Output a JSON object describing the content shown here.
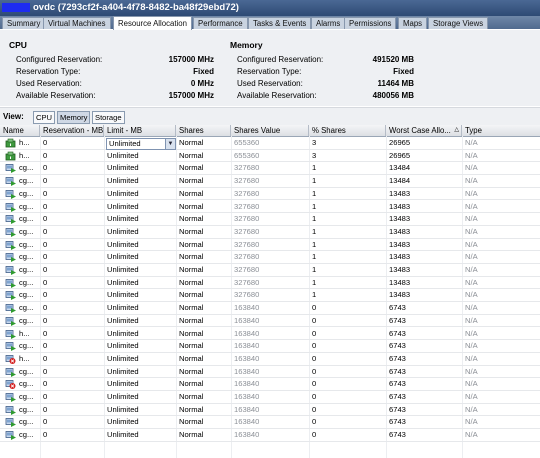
{
  "window": {
    "title": "ovdc (7293cf2f-a404-4f78-8482-ba48f29ebd72)"
  },
  "tabs": [
    {
      "label": "Summary",
      "active": false
    },
    {
      "label": "Virtual Machines",
      "active": false
    },
    {
      "label": "Resource Allocation",
      "active": true
    },
    {
      "label": "Performance",
      "active": false
    },
    {
      "label": "Tasks & Events",
      "active": false
    },
    {
      "label": "Alarms",
      "active": false
    },
    {
      "label": "Permissions",
      "active": false
    },
    {
      "label": "Maps",
      "active": false
    },
    {
      "label": "Storage Views",
      "active": false
    }
  ],
  "cpu": {
    "heading": "CPU",
    "rows": [
      {
        "label": "Configured Reservation:",
        "value": "157000 MHz"
      },
      {
        "label": "Reservation Type:",
        "value": "Fixed"
      },
      {
        "label": "Used Reservation:",
        "value": "0 MHz"
      },
      {
        "label": "Available Reservation:",
        "value": "157000 MHz"
      }
    ]
  },
  "memory": {
    "heading": "Memory",
    "rows": [
      {
        "label": "Configured Reservation:",
        "value": "491520 MB"
      },
      {
        "label": "Reservation Type:",
        "value": "Fixed"
      },
      {
        "label": "Used Reservation:",
        "value": "11464 MB"
      },
      {
        "label": "Available Reservation:",
        "value": "480056 MB"
      }
    ]
  },
  "view": {
    "label": "View:",
    "buttons": [
      {
        "label": "CPU",
        "selected": false
      },
      {
        "label": "Memory",
        "selected": true
      },
      {
        "label": "Storage",
        "selected": false
      }
    ]
  },
  "table": {
    "columns": [
      "Name",
      "Reservation - MB",
      "Limit - MB",
      "Shares",
      "Shares Value",
      "% Shares",
      "Worst Case Allo...",
      "Type"
    ],
    "sort_indicator": "△",
    "dropdown_arrow": "▼",
    "rows": [
      {
        "name": "h...",
        "reservation": "0",
        "limit": "Unlimited",
        "shares": "Normal",
        "shares_value": "655360",
        "pct": "3",
        "worst": "26965",
        "type": "N/A",
        "icon": "resource-pool-icon",
        "dropdown": true
      },
      {
        "name": "h...",
        "reservation": "0",
        "limit": "Unlimited",
        "shares": "Normal",
        "shares_value": "655360",
        "pct": "3",
        "worst": "26965",
        "type": "N/A",
        "icon": "resource-pool-icon"
      },
      {
        "name": "cg...",
        "reservation": "0",
        "limit": "Unlimited",
        "shares": "Normal",
        "shares_value": "327680",
        "pct": "1",
        "worst": "13484",
        "type": "N/A",
        "icon": "vm-on-icon"
      },
      {
        "name": "cg...",
        "reservation": "0",
        "limit": "Unlimited",
        "shares": "Normal",
        "shares_value": "327680",
        "pct": "1",
        "worst": "13484",
        "type": "N/A",
        "icon": "vm-on-icon"
      },
      {
        "name": "cg...",
        "reservation": "0",
        "limit": "Unlimited",
        "shares": "Normal",
        "shares_value": "327680",
        "pct": "1",
        "worst": "13483",
        "type": "N/A",
        "icon": "vm-on-icon"
      },
      {
        "name": "cg...",
        "reservation": "0",
        "limit": "Unlimited",
        "shares": "Normal",
        "shares_value": "327680",
        "pct": "1",
        "worst": "13483",
        "type": "N/A",
        "icon": "vm-on-icon"
      },
      {
        "name": "cg...",
        "reservation": "0",
        "limit": "Unlimited",
        "shares": "Normal",
        "shares_value": "327680",
        "pct": "1",
        "worst": "13483",
        "type": "N/A",
        "icon": "vm-on-icon"
      },
      {
        "name": "cg...",
        "reservation": "0",
        "limit": "Unlimited",
        "shares": "Normal",
        "shares_value": "327680",
        "pct": "1",
        "worst": "13483",
        "type": "N/A",
        "icon": "vm-on-icon"
      },
      {
        "name": "cg...",
        "reservation": "0",
        "limit": "Unlimited",
        "shares": "Normal",
        "shares_value": "327680",
        "pct": "1",
        "worst": "13483",
        "type": "N/A",
        "icon": "vm-on-icon"
      },
      {
        "name": "cg...",
        "reservation": "0",
        "limit": "Unlimited",
        "shares": "Normal",
        "shares_value": "327680",
        "pct": "1",
        "worst": "13483",
        "type": "N/A",
        "icon": "vm-on-icon"
      },
      {
        "name": "cg...",
        "reservation": "0",
        "limit": "Unlimited",
        "shares": "Normal",
        "shares_value": "327680",
        "pct": "1",
        "worst": "13483",
        "type": "N/A",
        "icon": "vm-on-icon"
      },
      {
        "name": "cg...",
        "reservation": "0",
        "limit": "Unlimited",
        "shares": "Normal",
        "shares_value": "327680",
        "pct": "1",
        "worst": "13483",
        "type": "N/A",
        "icon": "vm-on-icon"
      },
      {
        "name": "cg...",
        "reservation": "0",
        "limit": "Unlimited",
        "shares": "Normal",
        "shares_value": "327680",
        "pct": "1",
        "worst": "13483",
        "type": "N/A",
        "icon": "vm-on-icon"
      },
      {
        "name": "cg...",
        "reservation": "0",
        "limit": "Unlimited",
        "shares": "Normal",
        "shares_value": "163840",
        "pct": "0",
        "worst": "6743",
        "type": "N/A",
        "icon": "vm-on-icon"
      },
      {
        "name": "cg...",
        "reservation": "0",
        "limit": "Unlimited",
        "shares": "Normal",
        "shares_value": "163840",
        "pct": "0",
        "worst": "6743",
        "type": "N/A",
        "icon": "vm-on-icon"
      },
      {
        "name": "h...",
        "reservation": "0",
        "limit": "Unlimited",
        "shares": "Normal",
        "shares_value": "163840",
        "pct": "0",
        "worst": "6743",
        "type": "N/A",
        "icon": "vm-on-icon"
      },
      {
        "name": "cg...",
        "reservation": "0",
        "limit": "Unlimited",
        "shares": "Normal",
        "shares_value": "163840",
        "pct": "0",
        "worst": "6743",
        "type": "N/A",
        "icon": "vm-on-icon"
      },
      {
        "name": "h...",
        "reservation": "0",
        "limit": "Unlimited",
        "shares": "Normal",
        "shares_value": "163840",
        "pct": "0",
        "worst": "6743",
        "type": "N/A",
        "icon": "vm-alert-icon"
      },
      {
        "name": "cg...",
        "reservation": "0",
        "limit": "Unlimited",
        "shares": "Normal",
        "shares_value": "163840",
        "pct": "0",
        "worst": "6743",
        "type": "N/A",
        "icon": "vm-on-icon"
      },
      {
        "name": "cg...",
        "reservation": "0",
        "limit": "Unlimited",
        "shares": "Normal",
        "shares_value": "163840",
        "pct": "0",
        "worst": "6743",
        "type": "N/A",
        "icon": "vm-alert-icon"
      },
      {
        "name": "cg...",
        "reservation": "0",
        "limit": "Unlimited",
        "shares": "Normal",
        "shares_value": "163840",
        "pct": "0",
        "worst": "6743",
        "type": "N/A",
        "icon": "vm-on-icon"
      },
      {
        "name": "cg...",
        "reservation": "0",
        "limit": "Unlimited",
        "shares": "Normal",
        "shares_value": "163840",
        "pct": "0",
        "worst": "6743",
        "type": "N/A",
        "icon": "vm-on-icon"
      },
      {
        "name": "cg...",
        "reservation": "0",
        "limit": "Unlimited",
        "shares": "Normal",
        "shares_value": "163840",
        "pct": "0",
        "worst": "6743",
        "type": "N/A",
        "icon": "vm-on-icon"
      },
      {
        "name": "cg...",
        "reservation": "0",
        "limit": "Unlimited",
        "shares": "Normal",
        "shares_value": "163840",
        "pct": "0",
        "worst": "6743",
        "type": "N/A",
        "icon": "vm-on-icon"
      }
    ]
  }
}
